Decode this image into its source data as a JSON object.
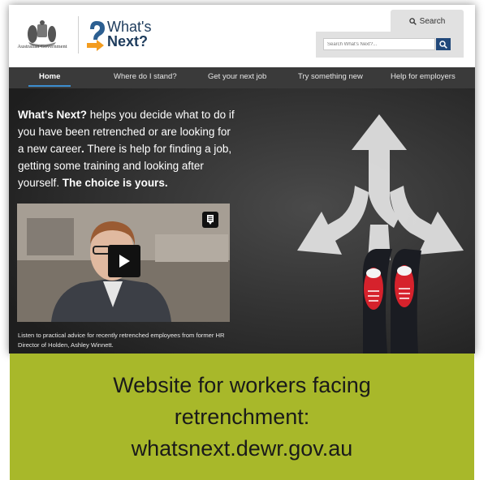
{
  "header": {
    "gov_name": "Australian Government",
    "brand_line1": "What's",
    "brand_line2": "Next?",
    "search_tab_label": "Search",
    "search_placeholder": "Search What's Next?..."
  },
  "nav": {
    "items": [
      {
        "label": "Home",
        "active": true
      },
      {
        "label": "Where do I stand?"
      },
      {
        "label": "Get your next job"
      },
      {
        "label": "Try something new"
      },
      {
        "label": "Help for employers"
      }
    ]
  },
  "hero": {
    "intro_bold_1": "What's Next?",
    "intro_text_1": " helps you decide what to do if you have been retrenched or are looking for a new career",
    "intro_bold_2": ".",
    "intro_text_2": " There is help for finding a job, getting some training and looking after yourself. ",
    "intro_bold_3": "The choice is yours.",
    "video_caption": "Listen to practical advice for recently retrenched employees from former HR Director of Holden, Ashley Winnett."
  },
  "banner": {
    "line1": "Website for workers facing",
    "line2": "retrenchment:",
    "line3": "whatsnext.dewr.gov.au"
  },
  "colors": {
    "nav_bg": "#3a3a3a",
    "nav_active_underline": "#3c8ed0",
    "brand_orange": "#f39c1f",
    "brand_navy": "#1d3b5c",
    "search_button": "#21487a",
    "banner_bg": "#a8b82a"
  },
  "icons": {
    "search": "search-icon",
    "play": "play-icon",
    "transcript": "transcript-icon",
    "coat_of_arms": "coat-of-arms-icon",
    "brand_mark": "question-arrow-icon"
  }
}
